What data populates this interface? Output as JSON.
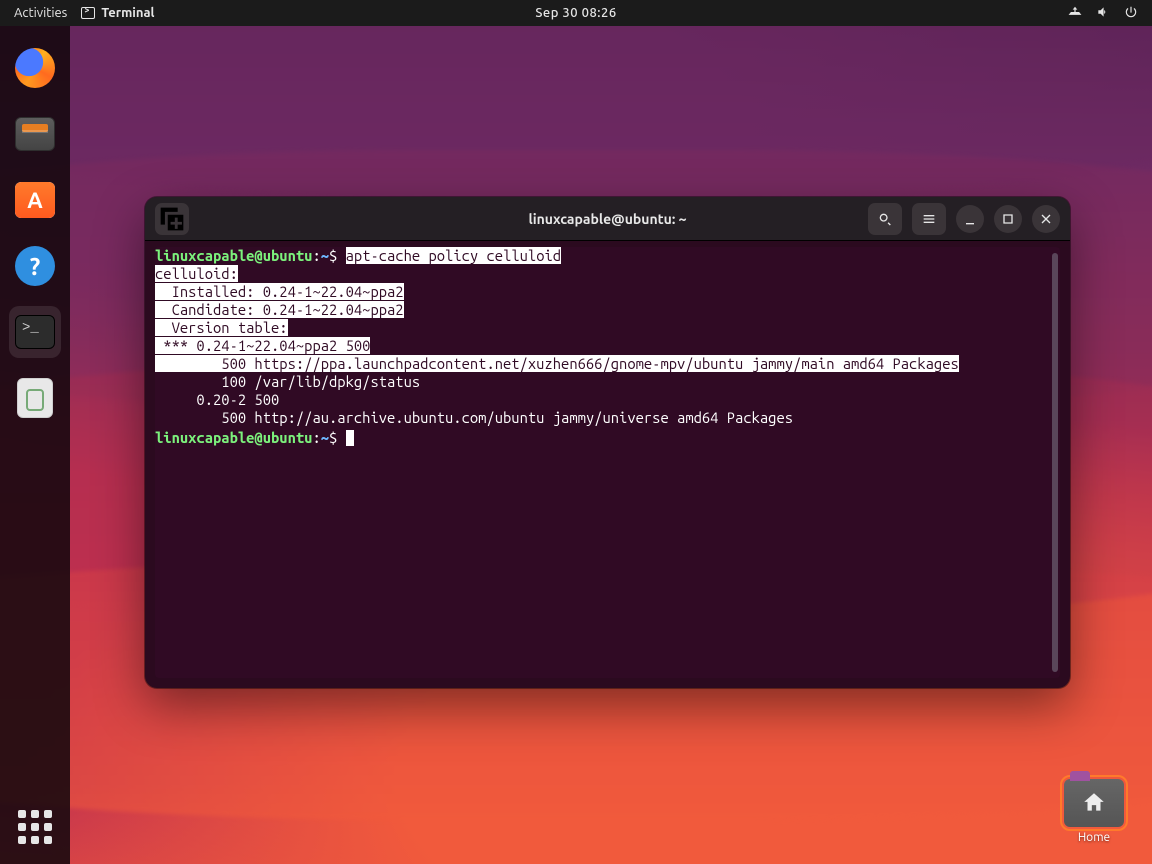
{
  "topbar": {
    "activities": "Activities",
    "app_name": "Terminal",
    "clock": "Sep 30  08:26",
    "icons": {
      "network": "network-icon",
      "volume": "volume-icon",
      "power": "power-icon"
    }
  },
  "dock": {
    "items": [
      {
        "name": "firefox",
        "label": "Firefox Web Browser"
      },
      {
        "name": "files",
        "label": "Files"
      },
      {
        "name": "software",
        "label": "Ubuntu Software"
      },
      {
        "name": "help",
        "label": "Help"
      },
      {
        "name": "terminal",
        "label": "Terminal",
        "active": true
      },
      {
        "name": "trash",
        "label": "Trash"
      }
    ],
    "apps_label": "Show Applications"
  },
  "desktop_icons": {
    "home_label": "Home"
  },
  "terminal_window": {
    "title": "linuxcapable@ubuntu: ~",
    "buttons": {
      "new_tab": "New Tab",
      "search": "Search",
      "menu": "Menu",
      "minimize": "Minimize",
      "maximize": "Maximize",
      "close": "Close"
    },
    "prompt": {
      "user_host": "linuxcapable@ubuntu",
      "sep1": ":",
      "path": "~",
      "sep2": "$ "
    },
    "command": "apt-cache policy celluloid",
    "output_highlighted": [
      "celluloid:",
      "  Installed: 0.24-1~22.04~ppa2",
      "  Candidate: 0.24-1~22.04~ppa2",
      "  Version table:",
      " *** 0.24-1~22.04~ppa2 500",
      "        500 https://ppa.launchpadcontent.net/xuzhen666/gnome-mpv/ubuntu jammy/main amd64 Packages"
    ],
    "output_normal": [
      "        100 /var/lib/dpkg/status",
      "     0.20-2 500",
      "        500 http://au.archive.ubuntu.com/ubuntu jammy/universe amd64 Packages"
    ]
  }
}
